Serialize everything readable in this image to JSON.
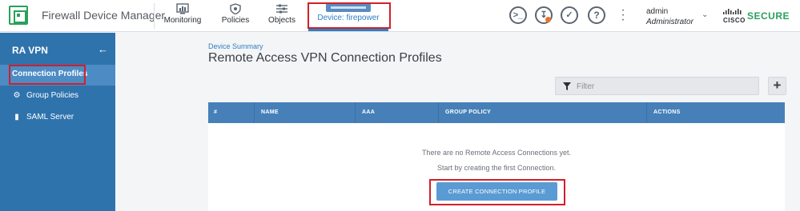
{
  "app": {
    "title": "Firewall Device Manager"
  },
  "nav": {
    "monitoring": "Monitoring",
    "policies": "Policies",
    "objects": "Objects",
    "device": "Device: firepower"
  },
  "user": {
    "name": "admin",
    "role": "Administrator"
  },
  "brand": {
    "cisco": "CISCO",
    "secure": "SECURE"
  },
  "sidebar": {
    "title": "RA VPN",
    "items": [
      {
        "label": "Connection Profiles",
        "icon": "none",
        "active": true
      },
      {
        "label": "Group Policies",
        "icon": "group-policies-icon"
      },
      {
        "label": "SAML Server",
        "icon": "saml-server-icon"
      }
    ]
  },
  "main": {
    "breadcrumb": "Device Summary",
    "title": "Remote Access VPN Connection Profiles",
    "filter_placeholder": "Filter",
    "table": {
      "columns": [
        "#",
        "NAME",
        "AAA",
        "GROUP POLICY",
        "ACTIONS"
      ],
      "empty_message": "There are no Remote Access Connections yet.",
      "empty_hint": "Start by creating the first Connection."
    },
    "create_button": "CREATE CONNECTION PROFILE"
  },
  "colors": {
    "accent": "#2f7fc1",
    "sidebar": "#2f73ad",
    "table_header": "#4780b8",
    "primary_button": "#5a9bd4",
    "highlight_box": "#d0202a",
    "brand_green": "#2aa05c",
    "notification_dot": "#e8742a"
  }
}
